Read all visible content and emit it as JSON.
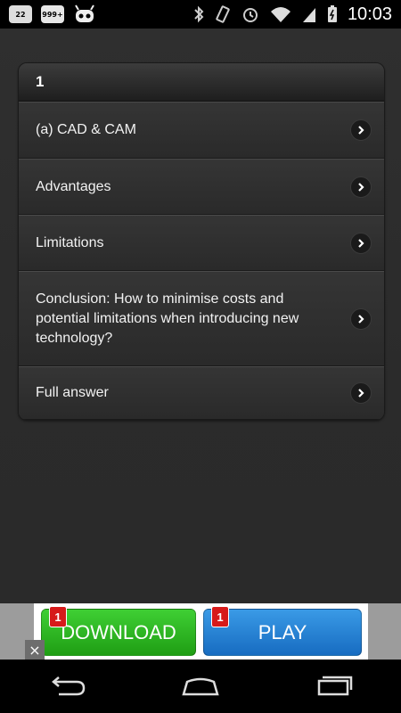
{
  "status_bar": {
    "notifications": [
      "22",
      "999+"
    ],
    "time": "10:03"
  },
  "list": {
    "header": "1",
    "items": [
      {
        "label": "(a) CAD & CAM"
      },
      {
        "label": "Advantages"
      },
      {
        "label": "Limitations"
      },
      {
        "label": "Conclusion: How to minimise costs and potential limitations when introducing new technology?"
      },
      {
        "label": "Full answer"
      }
    ]
  },
  "ad": {
    "download_label": "DOWNLOAD",
    "play_label": "PLAY",
    "badge_download": "1",
    "badge_play": "1",
    "close_label": "×"
  },
  "colors": {
    "background": "#2f2f2f",
    "download_green": "#2fb624",
    "play_blue": "#2a84d6",
    "badge_red": "#d61a1a"
  }
}
